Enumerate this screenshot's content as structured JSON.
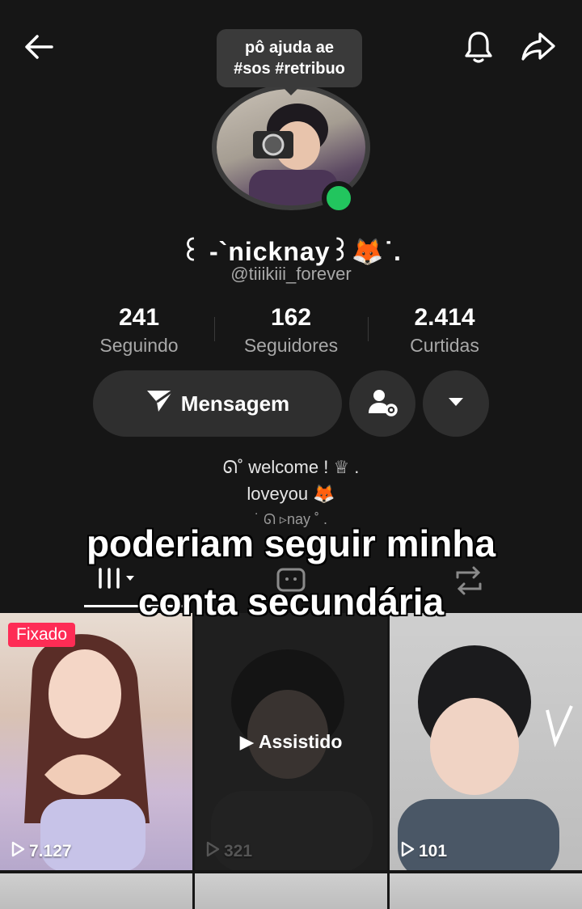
{
  "header": {
    "note_line1": "pô ajuda ae",
    "note_line2": "#sos #retribuo"
  },
  "profile": {
    "display_name": "꒰ -`nicknay꒱🦊˙.",
    "username": "@tiiikiii_forever",
    "online": true
  },
  "stats": [
    {
      "value": "241",
      "label": "Seguindo"
    },
    {
      "value": "162",
      "label": "Seguidores"
    },
    {
      "value": "2.414",
      "label": "Curtidas"
    }
  ],
  "actions": {
    "message_label": "Mensagem"
  },
  "bio": {
    "line1": "ᘏ˚ welcome ! ♕ .",
    "line2": "loveyou 🦊",
    "line3": "˙ ᘏ ▹nay ˚ ."
  },
  "caption": {
    "line1": "poderiam seguir minha",
    "line2": "conta secundária"
  },
  "videos": [
    {
      "badge": "Fixado",
      "views": "7.127"
    },
    {
      "overlay": "Assistido",
      "views": "321"
    },
    {
      "views": "101"
    }
  ],
  "icons": {
    "back": "arrow-left-icon",
    "bell": "bell-icon",
    "share": "share-arrow-icon",
    "send": "send-icon",
    "profile_settings": "user-gear-icon",
    "dropdown": "caret-down-icon"
  },
  "colors": {
    "background": "#161616",
    "online": "#22c55e",
    "pinned_badge": "#fe2c55"
  }
}
